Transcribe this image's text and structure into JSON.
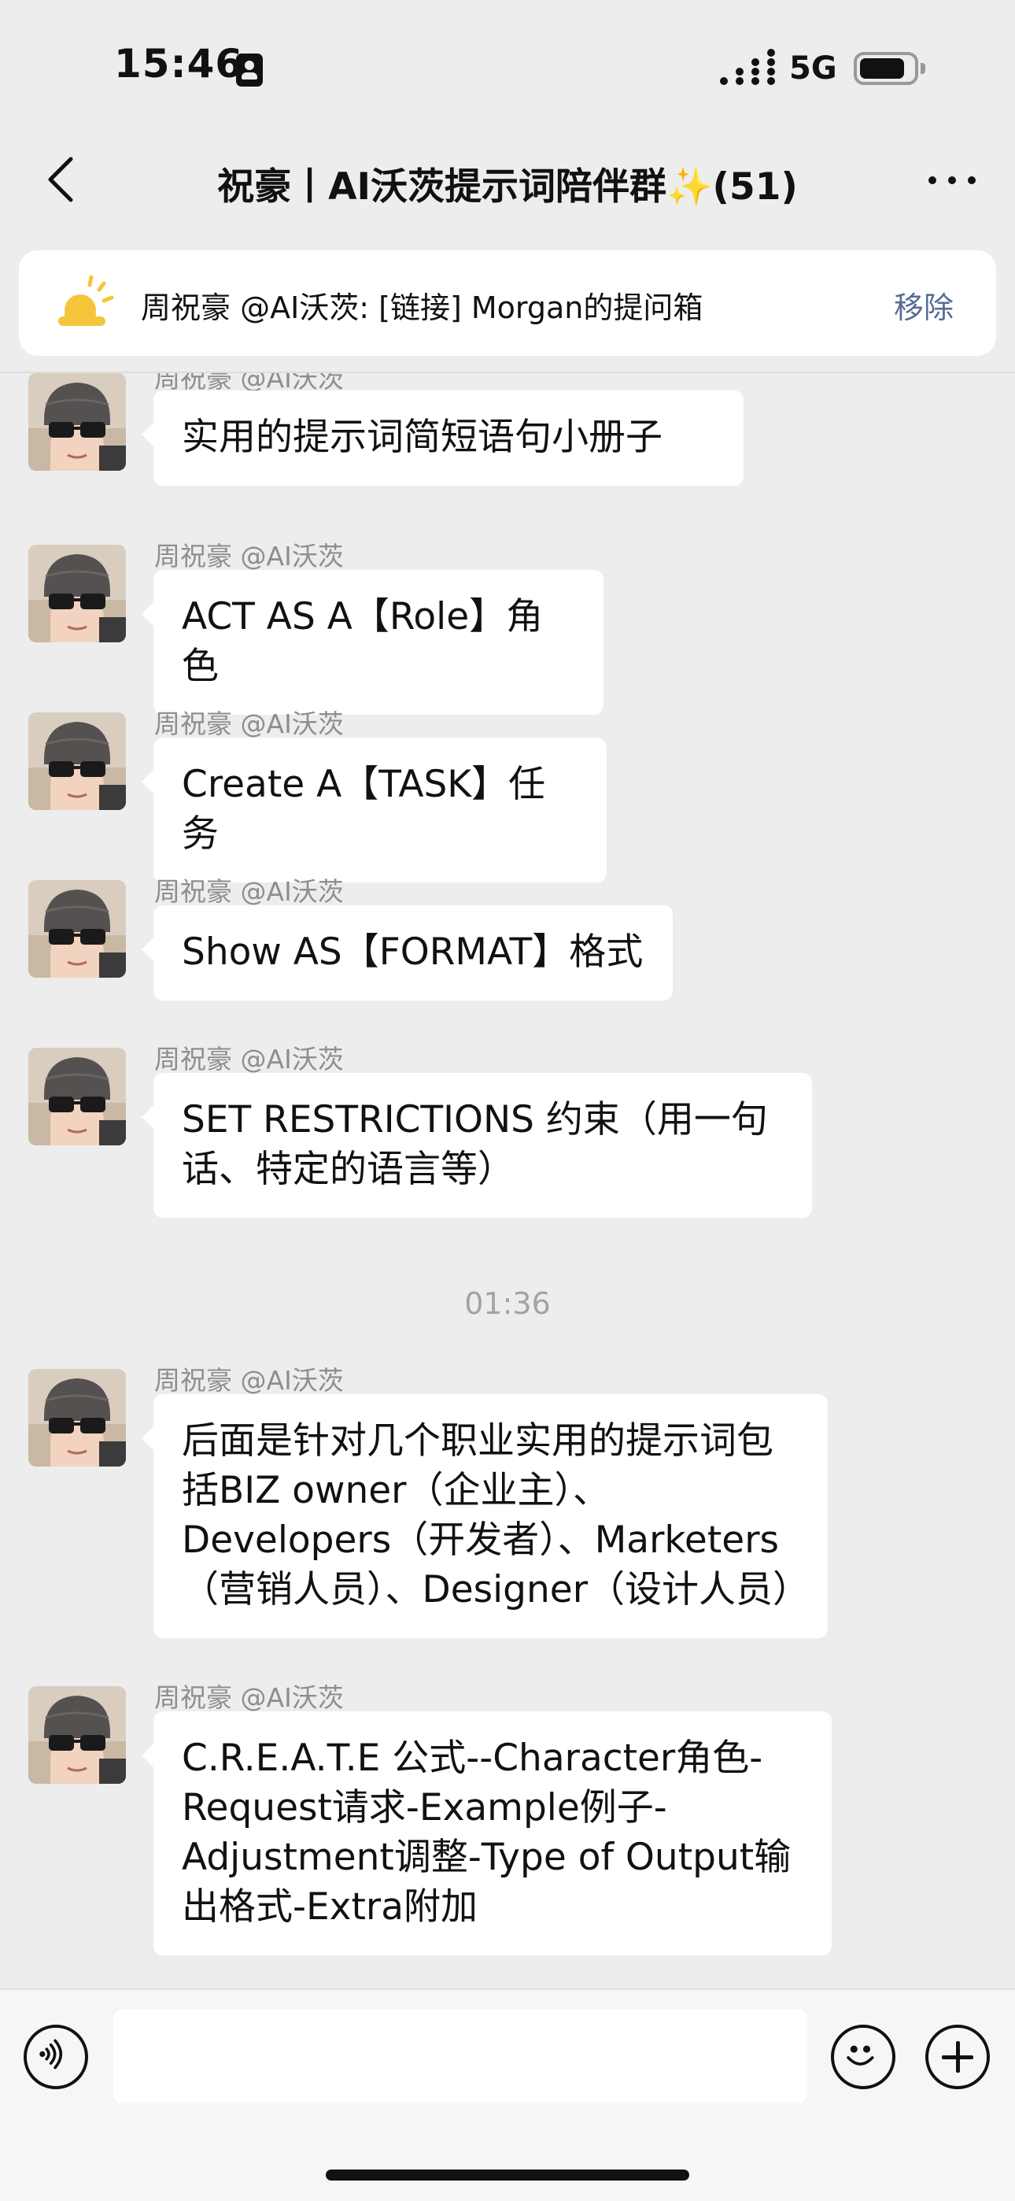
{
  "status_bar": {
    "time": "15:46",
    "network": "5G",
    "battery_level": 0.85,
    "icons": [
      "contact-card-icon",
      "signal-icon",
      "battery-icon"
    ]
  },
  "nav": {
    "title": "祝豪丨AI沃茨提示词陪伴群✨(51)",
    "icons": [
      "back-chevron-icon",
      "more-icon"
    ]
  },
  "pinned": {
    "text": "周祝豪 @AI沃茨: [链接] Morgan的提问箱",
    "action": "移除",
    "icon": "sun-icon"
  },
  "messages": [
    {
      "sender": "周祝豪 @AI沃茨",
      "text": "实用的提示词简短语句小册子"
    },
    {
      "sender": "周祝豪 @AI沃茨",
      "text": "ACT AS A【Role】角色"
    },
    {
      "sender": "周祝豪 @AI沃茨",
      "text": "Create A【TASK】任务"
    },
    {
      "sender": "周祝豪 @AI沃茨",
      "text": "Show AS【FORMAT】格式"
    },
    {
      "sender": "周祝豪 @AI沃茨",
      "text": "SET RESTRICTIONS 约束（用一句话、特定的语言等）"
    },
    {
      "sender": "周祝豪 @AI沃茨",
      "text": "后面是针对几个职业实用的提示词包括BIZ owner（企业主）、Developers（开发者）、Marketers（营销人员）、Designer（设计人员）"
    },
    {
      "sender": "周祝豪 @AI沃茨",
      "text": "C.R.E.A.T.E 公式--Character角色-Request请求-Example例子-Adjustment调整-Type of Output输出格式-Extra附加"
    }
  ],
  "timestamp": "01:36",
  "input": {
    "value": "",
    "placeholder": "",
    "icons": [
      "voice-icon",
      "emoji-icon",
      "plus-icon"
    ]
  }
}
